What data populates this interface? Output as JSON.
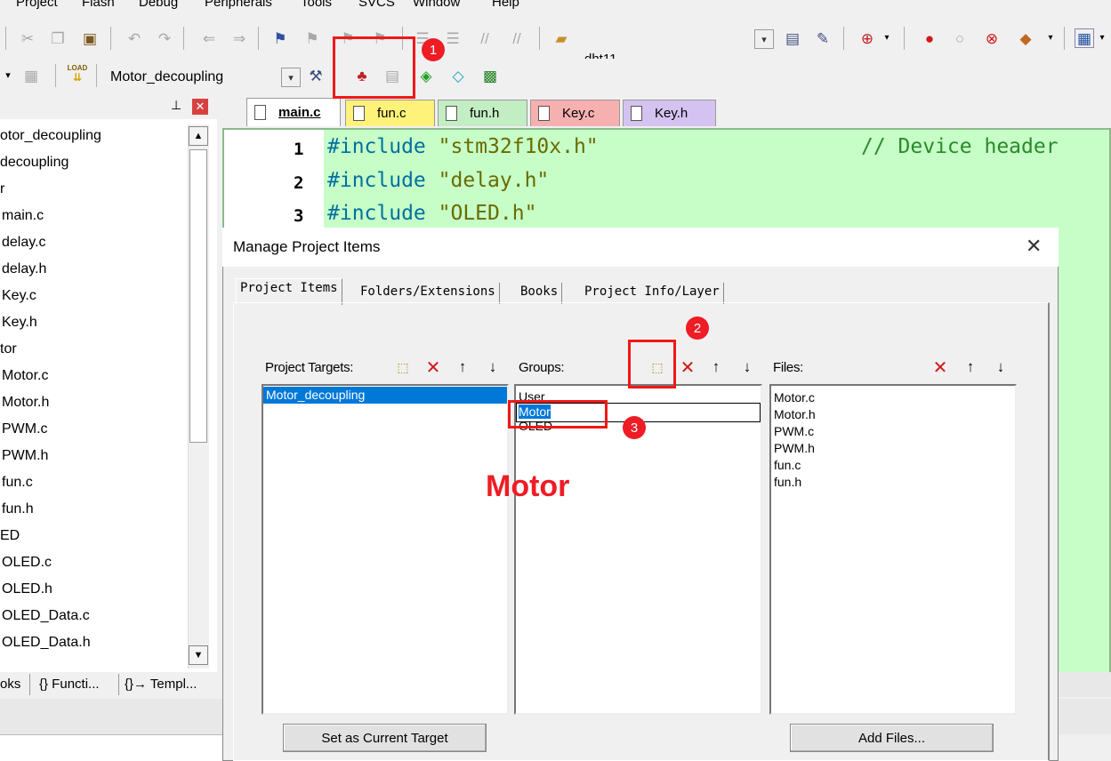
{
  "menu": [
    "Project",
    "Flash",
    "Debug",
    "Peripherals",
    "Tools",
    "SVCS",
    "Window",
    "Help"
  ],
  "toolbar1": {
    "target_name": "dht11"
  },
  "toolbar2": {
    "target_combo": "Motor_decoupling",
    "load_label": "LOAD"
  },
  "project_tree": {
    "items": [
      "otor_decoupling",
      "decoupling",
      "r",
      "main.c",
      "delay.c",
      "delay.h",
      "Key.c",
      "Key.h",
      "tor",
      "Motor.c",
      "Motor.h",
      "PWM.c",
      "PWM.h",
      "fun.c",
      "fun.h",
      "ED",
      "OLED.c",
      "OLED.h",
      "OLED_Data.c",
      "OLED_Data.h"
    ],
    "bottom_tabs": [
      "oks",
      "{} Functi...",
      "{}→ Templ..."
    ]
  },
  "editor": {
    "tabs": [
      "main.c",
      "fun.c",
      "fun.h",
      "Key.c",
      "Key.h"
    ],
    "lines": [
      {
        "n": "1",
        "kw": "#include",
        "str": "\"stm32f10x.h\"",
        "comment": "// Device header"
      },
      {
        "n": "2",
        "kw": "#include",
        "str": "\"delay.h\"",
        "comment": ""
      },
      {
        "n": "3",
        "kw": "#include",
        "str": "\"OLED.h\"",
        "comment": ""
      }
    ]
  },
  "dialog": {
    "title": "Manage Project Items",
    "tabs": [
      "Project Items",
      "Folders/Extensions",
      "Books",
      "Project Info/Layer"
    ],
    "targets_label": "Project Targets:",
    "targets": [
      "Motor_decoupling"
    ],
    "groups_label": "Groups:",
    "groups": [
      "User",
      "Motor",
      "OLED"
    ],
    "files_label": "Files:",
    "files": [
      "Motor.c",
      "Motor.h",
      "PWM.c",
      "PWM.h",
      "fun.c",
      "fun.h"
    ],
    "set_target_button": "Set as Current Target",
    "add_files_button": "Add Files..."
  },
  "annotations": {
    "badges": [
      "1",
      "2",
      "3"
    ],
    "overlay_text": "Motor",
    "color": "#ee1c24"
  },
  "colors": {
    "editor_bg": "#c7fec7",
    "selection": "#0078d7"
  }
}
